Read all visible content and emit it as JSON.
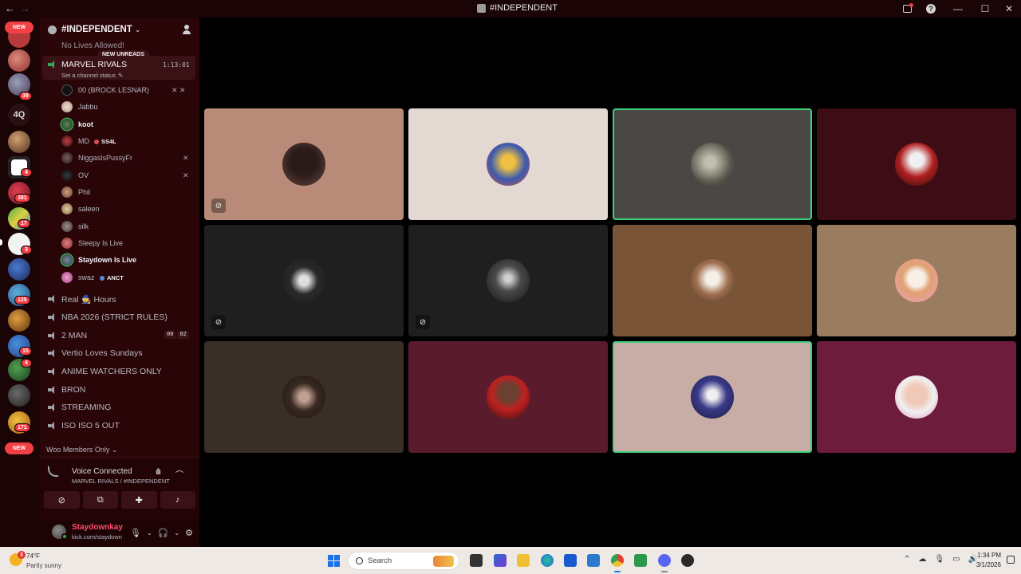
{
  "window": {
    "title": "#INDEPENDENT",
    "nav_back": "←",
    "nav_forward": "→",
    "help": "?",
    "minimize": "—",
    "maximize": "☐",
    "close": "✕"
  },
  "rail": {
    "new_top": "NEW",
    "new_bottom": "NEW",
    "text_server": "4Q",
    "badges": [
      "39",
      "4",
      "381",
      "17",
      "3",
      "125",
      "15",
      "4",
      "171"
    ]
  },
  "guild": {
    "name": "#INDEPENDENT",
    "faded_channel": "No Lives Allowed!",
    "new_unreads": "NEW UNREADS",
    "active_channel": "MARVEL RIVALS",
    "timer": "1:13:01",
    "status_prompt": "Set a channel status"
  },
  "members": [
    {
      "name": "00 (BROCK LESNAR)",
      "bold": false,
      "tag": "",
      "status": "✕ ✕"
    },
    {
      "name": "Jabbu",
      "bold": false,
      "tag": "",
      "status": ""
    },
    {
      "name": "koot",
      "bold": true,
      "tag": "",
      "status": ""
    },
    {
      "name": "MD",
      "bold": false,
      "tag": "SS4L",
      "status": ""
    },
    {
      "name": "NiggasIsPussyFr",
      "bold": false,
      "tag": "",
      "status": "✕"
    },
    {
      "name": "OV",
      "bold": false,
      "tag": "",
      "status": "✕"
    },
    {
      "name": "Phil",
      "bold": false,
      "tag": "",
      "status": ""
    },
    {
      "name": "saleen",
      "bold": false,
      "tag": "",
      "status": ""
    },
    {
      "name": "silk",
      "bold": false,
      "tag": "",
      "status": ""
    },
    {
      "name": "Sleepy Is Live",
      "bold": false,
      "tag": "",
      "status": ""
    },
    {
      "name": "Staydown Is Live",
      "bold": true,
      "tag": "",
      "status": ""
    },
    {
      "name": "swaz",
      "bold": false,
      "tag": "ANCT",
      "status": ""
    }
  ],
  "channels": [
    {
      "name": "Real 🧙 Hours"
    },
    {
      "name": "NBA 2026 (STRICT RULES)"
    },
    {
      "name": "2 MAN"
    },
    {
      "name": "Vertio Loves Sundays"
    },
    {
      "name": "ANIME WATCHERS ONLY"
    },
    {
      "name": "BRON"
    },
    {
      "name": "STREAMING"
    },
    {
      "name": "ISO ISO 5 OUT"
    }
  ],
  "live_counts": [
    "00",
    "02"
  ],
  "category": "Woo Members Only ⌄",
  "voice": {
    "title": "Voice Connected",
    "subtitle": "MARVEL RIVALS / #INDEPENDENT"
  },
  "user": {
    "name": "Staydownkay",
    "sub": "kick.com/staydown"
  },
  "taskbar": {
    "temp": "74°F",
    "condition": "Partly sunny",
    "weather_badge": "3",
    "search": "Search",
    "time": "1:34 PM",
    "date": "3/1/2026"
  },
  "colors": {
    "accent_red": "#f23f43",
    "speaking_green": "#3fd07a",
    "sidebar_bg": "#2a0508"
  }
}
